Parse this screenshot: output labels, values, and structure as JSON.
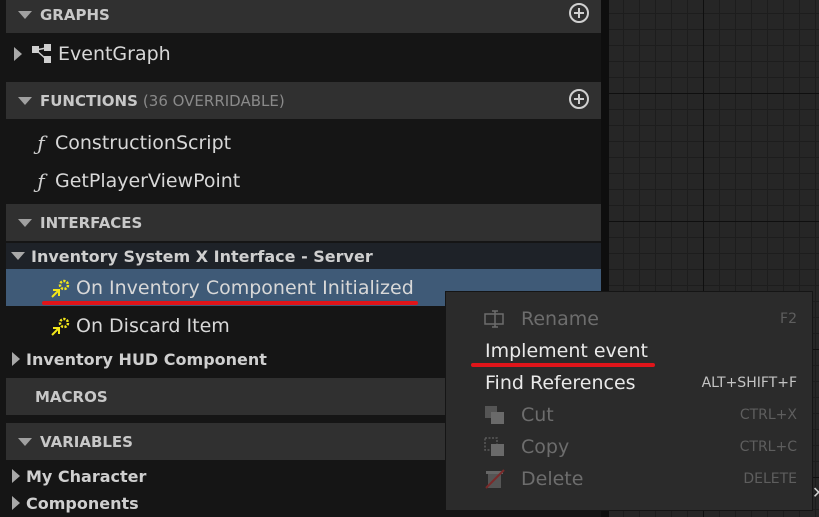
{
  "sections": {
    "graphs": {
      "title": "GRAPHS",
      "items": [
        {
          "label": "EventGraph",
          "icon": "event-graph-icon"
        }
      ]
    },
    "functions": {
      "title": "FUNCTIONS",
      "overridable": "(36 OVERRIDABLE)",
      "items": [
        {
          "label": "ConstructionScript",
          "icon": "construction-function-icon"
        },
        {
          "label": "GetPlayerViewPoint",
          "icon": "function-icon"
        }
      ]
    },
    "interfaces": {
      "title": "INTERFACES",
      "groups": [
        {
          "label": "Inventory System X Interface - Server",
          "expanded": true,
          "items": [
            {
              "label": "On Inventory Component Initialized",
              "icon": "interface-event-icon",
              "selected": true
            },
            {
              "label": "On Discard Item",
              "icon": "interface-event-icon",
              "selected": false
            }
          ]
        },
        {
          "label": "Inventory HUD Component",
          "expanded": false
        }
      ]
    },
    "macros": {
      "title": "MACROS"
    },
    "variables": {
      "title": "VARIABLES",
      "groups": [
        {
          "label": "My Character"
        },
        {
          "label": "Components"
        }
      ]
    }
  },
  "context_menu": {
    "items": [
      {
        "label": "Rename",
        "shortcut": "F2",
        "enabled": false,
        "icon": "rename-icon"
      },
      {
        "label": "Implement event",
        "shortcut": "",
        "enabled": true,
        "icon": ""
      },
      {
        "label": "Find References",
        "shortcut": "ALT+SHIFT+F",
        "enabled": true,
        "icon": ""
      },
      {
        "label": "Cut",
        "shortcut": "CTRL+X",
        "enabled": false,
        "icon": "cut-icon"
      },
      {
        "label": "Copy",
        "shortcut": "CTRL+C",
        "enabled": false,
        "icon": "copy-icon"
      },
      {
        "label": "Delete",
        "shortcut": "DELETE",
        "enabled": false,
        "icon": "delete-icon"
      }
    ]
  },
  "colors": {
    "selection": "#3f5a77",
    "highlight_underline": "#e0151a",
    "event_icon": "#f2e61a"
  }
}
